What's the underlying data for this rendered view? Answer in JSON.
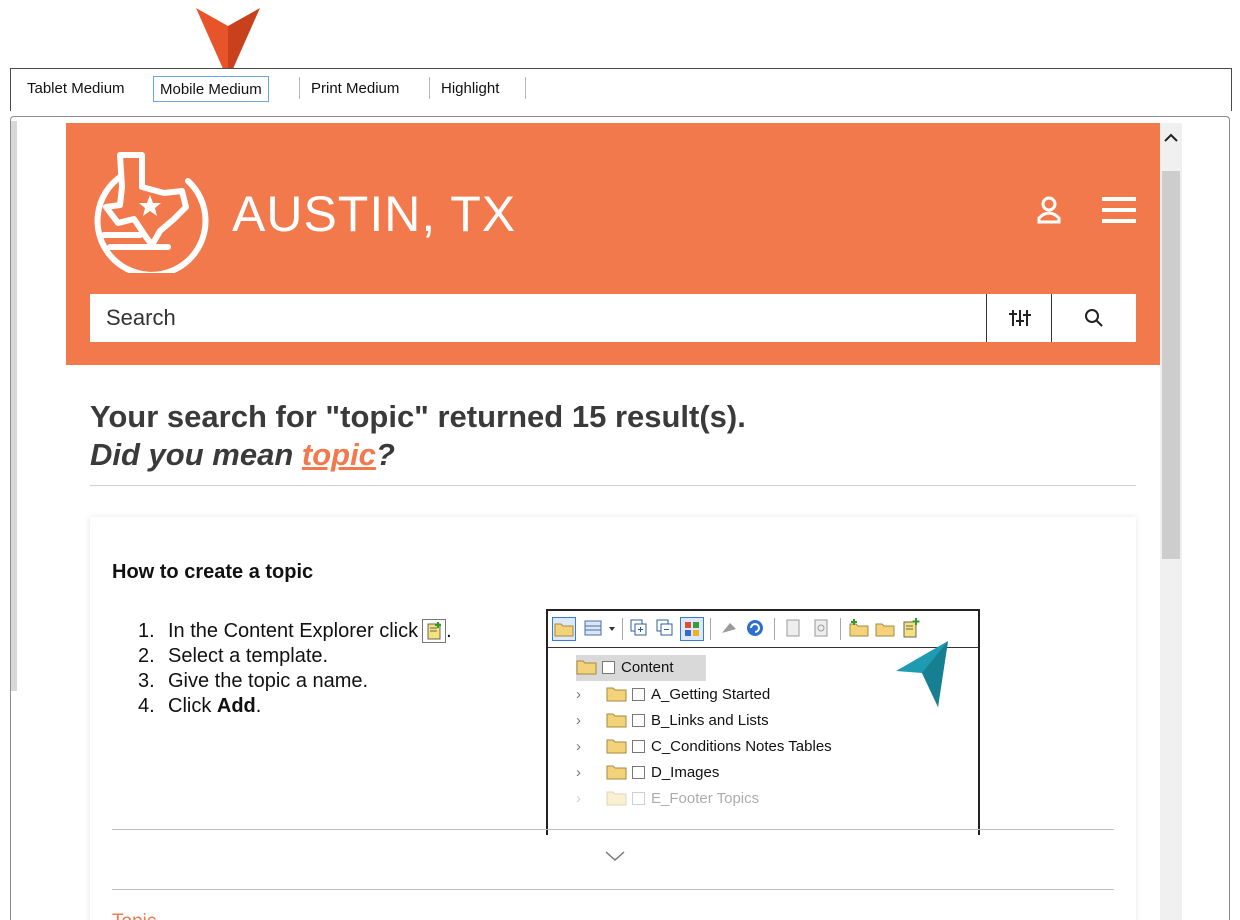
{
  "tabs": [
    {
      "label": "Tablet Medium",
      "selected": false
    },
    {
      "label": "Mobile Medium",
      "selected": true
    },
    {
      "label": "Print Medium",
      "selected": false
    },
    {
      "label": "Highlight",
      "selected": false
    }
  ],
  "colors": {
    "brand": "#f1794b",
    "annotation_arrow": "#e8542a",
    "callout_arrow": "#1e9bb0",
    "tab_selected_border": "#6aa6e0"
  },
  "site": {
    "title": "AUSTIN, TX",
    "logo_icon": "texas-map-logo-icon",
    "user_icon": "user-icon",
    "menu_icon": "hamburger-menu-icon"
  },
  "search": {
    "placeholder": "Search",
    "filter_icon": "filter-sliders-icon",
    "search_icon": "magnifier-icon"
  },
  "results": {
    "heading": "Your search for \"topic\" returned 15 result(s).",
    "suggest_prefix": "Did you mean ",
    "suggest_link": "topic",
    "suggest_suffix": "?"
  },
  "card": {
    "title": "How to create a topic",
    "steps": [
      {
        "num": "1.",
        "text": "In the Content Explorer click",
        "suffix": "."
      },
      {
        "num": "2.",
        "text": "Select a template."
      },
      {
        "num": "3.",
        "text": "Give the topic a name."
      },
      {
        "num": "4.",
        "text": "Click ",
        "bold": "Add",
        "suffix": "."
      }
    ],
    "explorer": {
      "root": "Content",
      "items": [
        "A_Getting Started",
        "B_Links and Lists",
        "C_Conditions Notes Tables",
        "D_Images",
        "E_Footer Topics"
      ],
      "faded_items": [
        "E_Footer Topics"
      ]
    },
    "next_result_peek": "Topic"
  }
}
